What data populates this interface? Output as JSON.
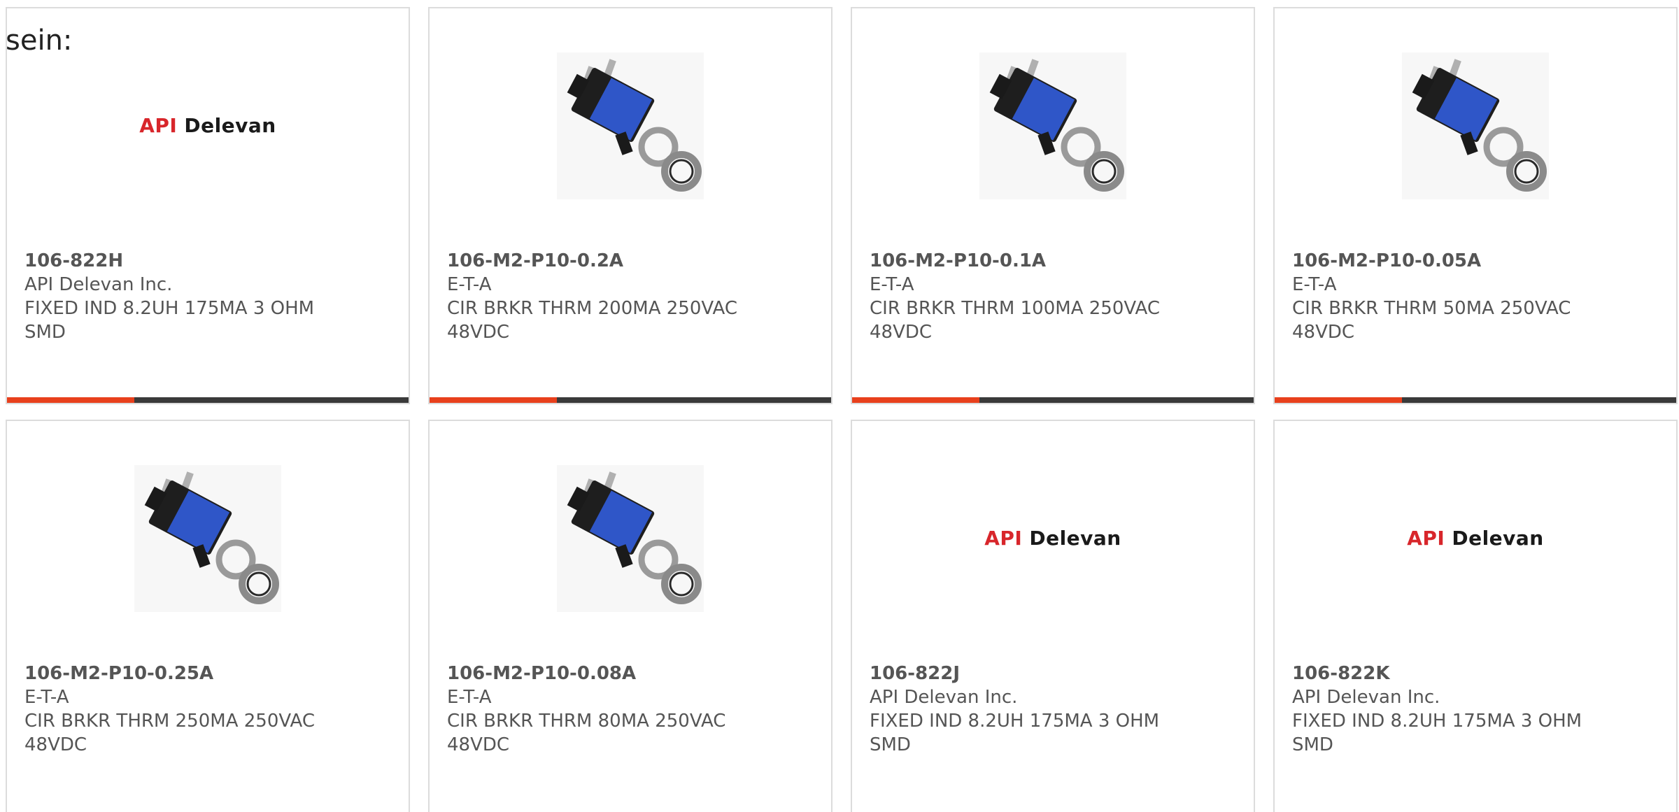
{
  "intro_text": "sein:",
  "colors": {
    "accent": "#e8401c",
    "bar": "#3a3a3a",
    "logo_red": "#d8262b",
    "text": "#555555"
  },
  "logo": {
    "api": "API",
    "delevan": "Delevan"
  },
  "products": [
    {
      "part": "106-822H",
      "maker": "API Delevan Inc.",
      "desc1": "FIXED IND 8.2UH 175MA 3 OHM",
      "desc2": "SMD",
      "image": "logo"
    },
    {
      "part": "106-M2-P10-0.2A",
      "maker": "E-T-A",
      "desc1": "CIR BRKR THRM 200MA 250VAC",
      "desc2": "48VDC",
      "image": "breaker"
    },
    {
      "part": "106-M2-P10-0.1A",
      "maker": "E-T-A",
      "desc1": "CIR BRKR THRM 100MA 250VAC",
      "desc2": "48VDC",
      "image": "breaker"
    },
    {
      "part": "106-M2-P10-0.05A",
      "maker": "E-T-A",
      "desc1": "CIR BRKR THRM 50MA 250VAC",
      "desc2": "48VDC",
      "image": "breaker"
    },
    {
      "part": "106-M2-P10-0.25A",
      "maker": "E-T-A",
      "desc1": "CIR BRKR THRM 250MA 250VAC",
      "desc2": "48VDC",
      "image": "breaker"
    },
    {
      "part": "106-M2-P10-0.08A",
      "maker": "E-T-A",
      "desc1": "CIR BRKR THRM 80MA 250VAC",
      "desc2": "48VDC",
      "image": "breaker"
    },
    {
      "part": "106-822J",
      "maker": "API Delevan Inc.",
      "desc1": "FIXED IND 8.2UH 175MA 3 OHM",
      "desc2": "SMD",
      "image": "logo"
    },
    {
      "part": "106-822K",
      "maker": "API Delevan Inc.",
      "desc1": "FIXED IND 8.2UH 175MA 3 OHM",
      "desc2": "SMD",
      "image": "logo"
    }
  ]
}
